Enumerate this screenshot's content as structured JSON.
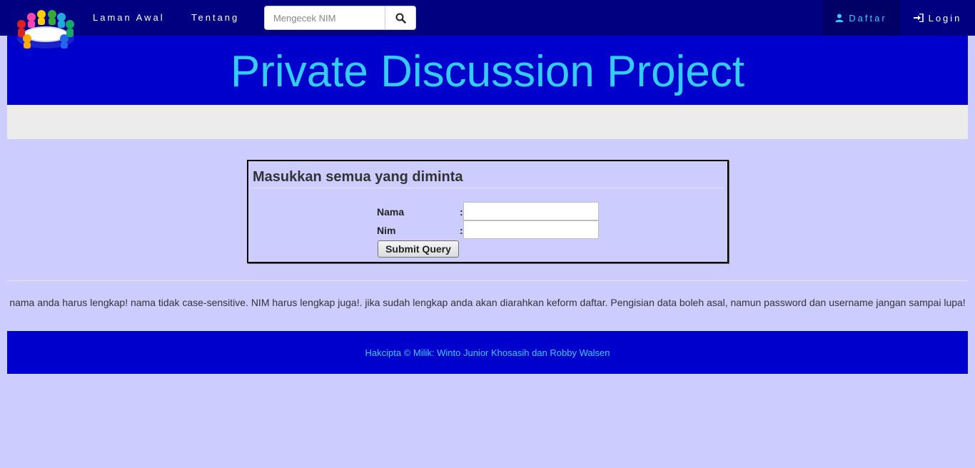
{
  "nav": {
    "links": [
      "Laman Awal",
      "Tentang"
    ],
    "search_placeholder": "Mengecek NIM",
    "daftar_label": "Daftar",
    "login_label": "Login"
  },
  "header": {
    "title": "Private Discussion Project"
  },
  "form": {
    "title": "Masukkan semua yang diminta",
    "nama_label": "Nama",
    "nim_label": "Nim",
    "colon": ":",
    "submit_label": "Submit Query"
  },
  "note": "nama anda harus lengkap! nama tidak case-sensitive. NIM harus lengkap juga!. jika sudah lengkap anda akan diarahkan keform daftar. Pengisian data boleh asal, namun password dan username jangan sampai lupa!",
  "footer": {
    "text": "Hakcipta © Milik: Winto Junior Khosasih dan Robby Walsen"
  },
  "colors": {
    "navbar": "#000080",
    "banner": "#0000cc",
    "accent": "#33ccff",
    "page_bg": "#ccccff"
  }
}
